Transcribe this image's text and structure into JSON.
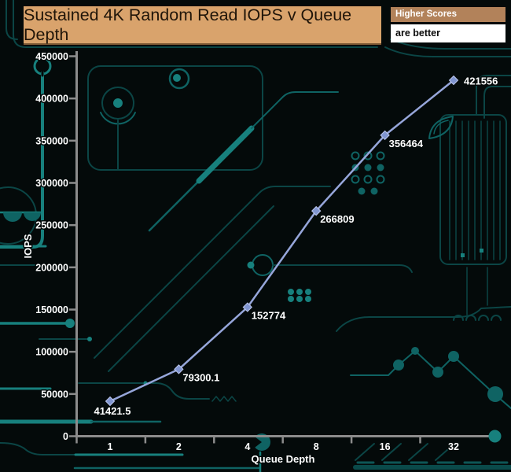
{
  "header": {
    "title": "Sustained 4K Random Read IOPS v Queue Depth",
    "note_primary": "Higher Scores",
    "note_secondary": "are better"
  },
  "colors": {
    "background": "#040a0a",
    "title_bg": "#d9a36c",
    "title_text": "#201509",
    "note_bg": "#b2825a",
    "note_text": "#ffffff",
    "note_secondary_bg": "#ffffff",
    "note_secondary_text": "#0a0a0a",
    "axis": "#8c8c8c",
    "line": "#96a6da",
    "marker": "#8095d0",
    "marker_edge": "#bcc7ec",
    "label_text": "#ffffff",
    "trace_bright": "#17807d",
    "trace_mid": "#0f6363",
    "trace_dim": "#0b4545"
  },
  "chart_data": {
    "type": "line",
    "title": "Sustained 4K Random Read IOPS v Queue Depth",
    "xlabel": "Queue Depth",
    "ylabel": "IOPS",
    "categories": [
      "1",
      "2",
      "4",
      "8",
      "16",
      "32"
    ],
    "series": [
      {
        "name": "Sustained 4K Random Read IOPS",
        "values": [
          41421.5,
          79300.1,
          152774,
          266809,
          356464,
          421556
        ]
      }
    ],
    "point_labels": [
      "41421.5",
      "79300.1",
      "152774",
      "266809",
      "356464",
      "421556"
    ],
    "ylim": [
      0,
      450000
    ],
    "yticks": [
      0,
      50000,
      100000,
      150000,
      200000,
      250000,
      300000,
      350000,
      400000,
      450000
    ],
    "grid": false,
    "legend": "none",
    "marker": "diamond",
    "note": "Higher Scores are better"
  }
}
